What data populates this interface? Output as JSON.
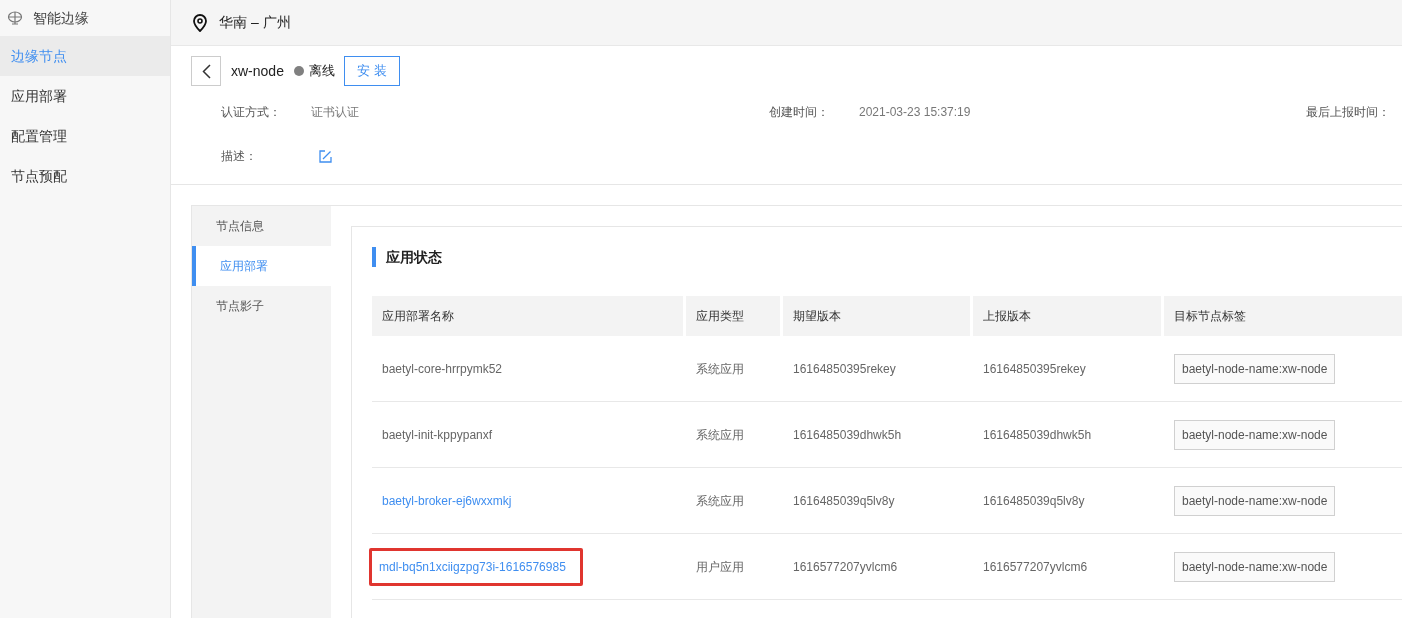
{
  "sidebar": {
    "title": "智能边缘",
    "items": [
      {
        "label": "边缘节点",
        "selected": true
      },
      {
        "label": "应用部署",
        "selected": false
      },
      {
        "label": "配置管理",
        "selected": false
      },
      {
        "label": "节点预配",
        "selected": false
      }
    ]
  },
  "header": {
    "location": "华南 – 广州"
  },
  "node": {
    "name": "xw-node",
    "status": "离线",
    "online": false,
    "install_button": "安 装",
    "fields": [
      {
        "label": "认证方式：",
        "value": "证书认证"
      },
      {
        "label": "创建时间：",
        "value": "2021-03-23 15:37:19"
      },
      {
        "label": "最后上报时间："
      }
    ],
    "description_label": "描述："
  },
  "tabs": [
    {
      "label": "节点信息",
      "selected": false
    },
    {
      "label": "应用部署",
      "selected": true
    },
    {
      "label": "节点影子",
      "selected": false
    }
  ],
  "section_title": "应用状态",
  "table": {
    "columns": [
      "应用部署名称",
      "应用类型",
      "期望版本",
      "上报版本",
      "目标节点标签"
    ],
    "rows": [
      {
        "name": "baetyl-core-hrrpymk52",
        "link": false,
        "highlighted": false,
        "type": "系统应用",
        "expected": "16164850395rekey",
        "reported": "16164850395rekey",
        "tag": "baetyl-node-name:xw-node"
      },
      {
        "name": "baetyl-init-kppypanxf",
        "link": false,
        "highlighted": false,
        "type": "系统应用",
        "expected": "1616485039dhwk5h",
        "reported": "1616485039dhwk5h",
        "tag": "baetyl-node-name:xw-node"
      },
      {
        "name": "baetyl-broker-ej6wxxmkj",
        "link": true,
        "highlighted": false,
        "type": "系统应用",
        "expected": "1616485039q5lv8y",
        "reported": "1616485039q5lv8y",
        "tag": "baetyl-node-name:xw-node"
      },
      {
        "name": "mdl-bq5n1xciigzpg73i-1616576985",
        "link": true,
        "highlighted": true,
        "type": "用户应用",
        "expected": "1616577207yvlcm6",
        "reported": "1616577207yvlcm6",
        "tag": "baetyl-node-name:xw-node"
      }
    ]
  }
}
